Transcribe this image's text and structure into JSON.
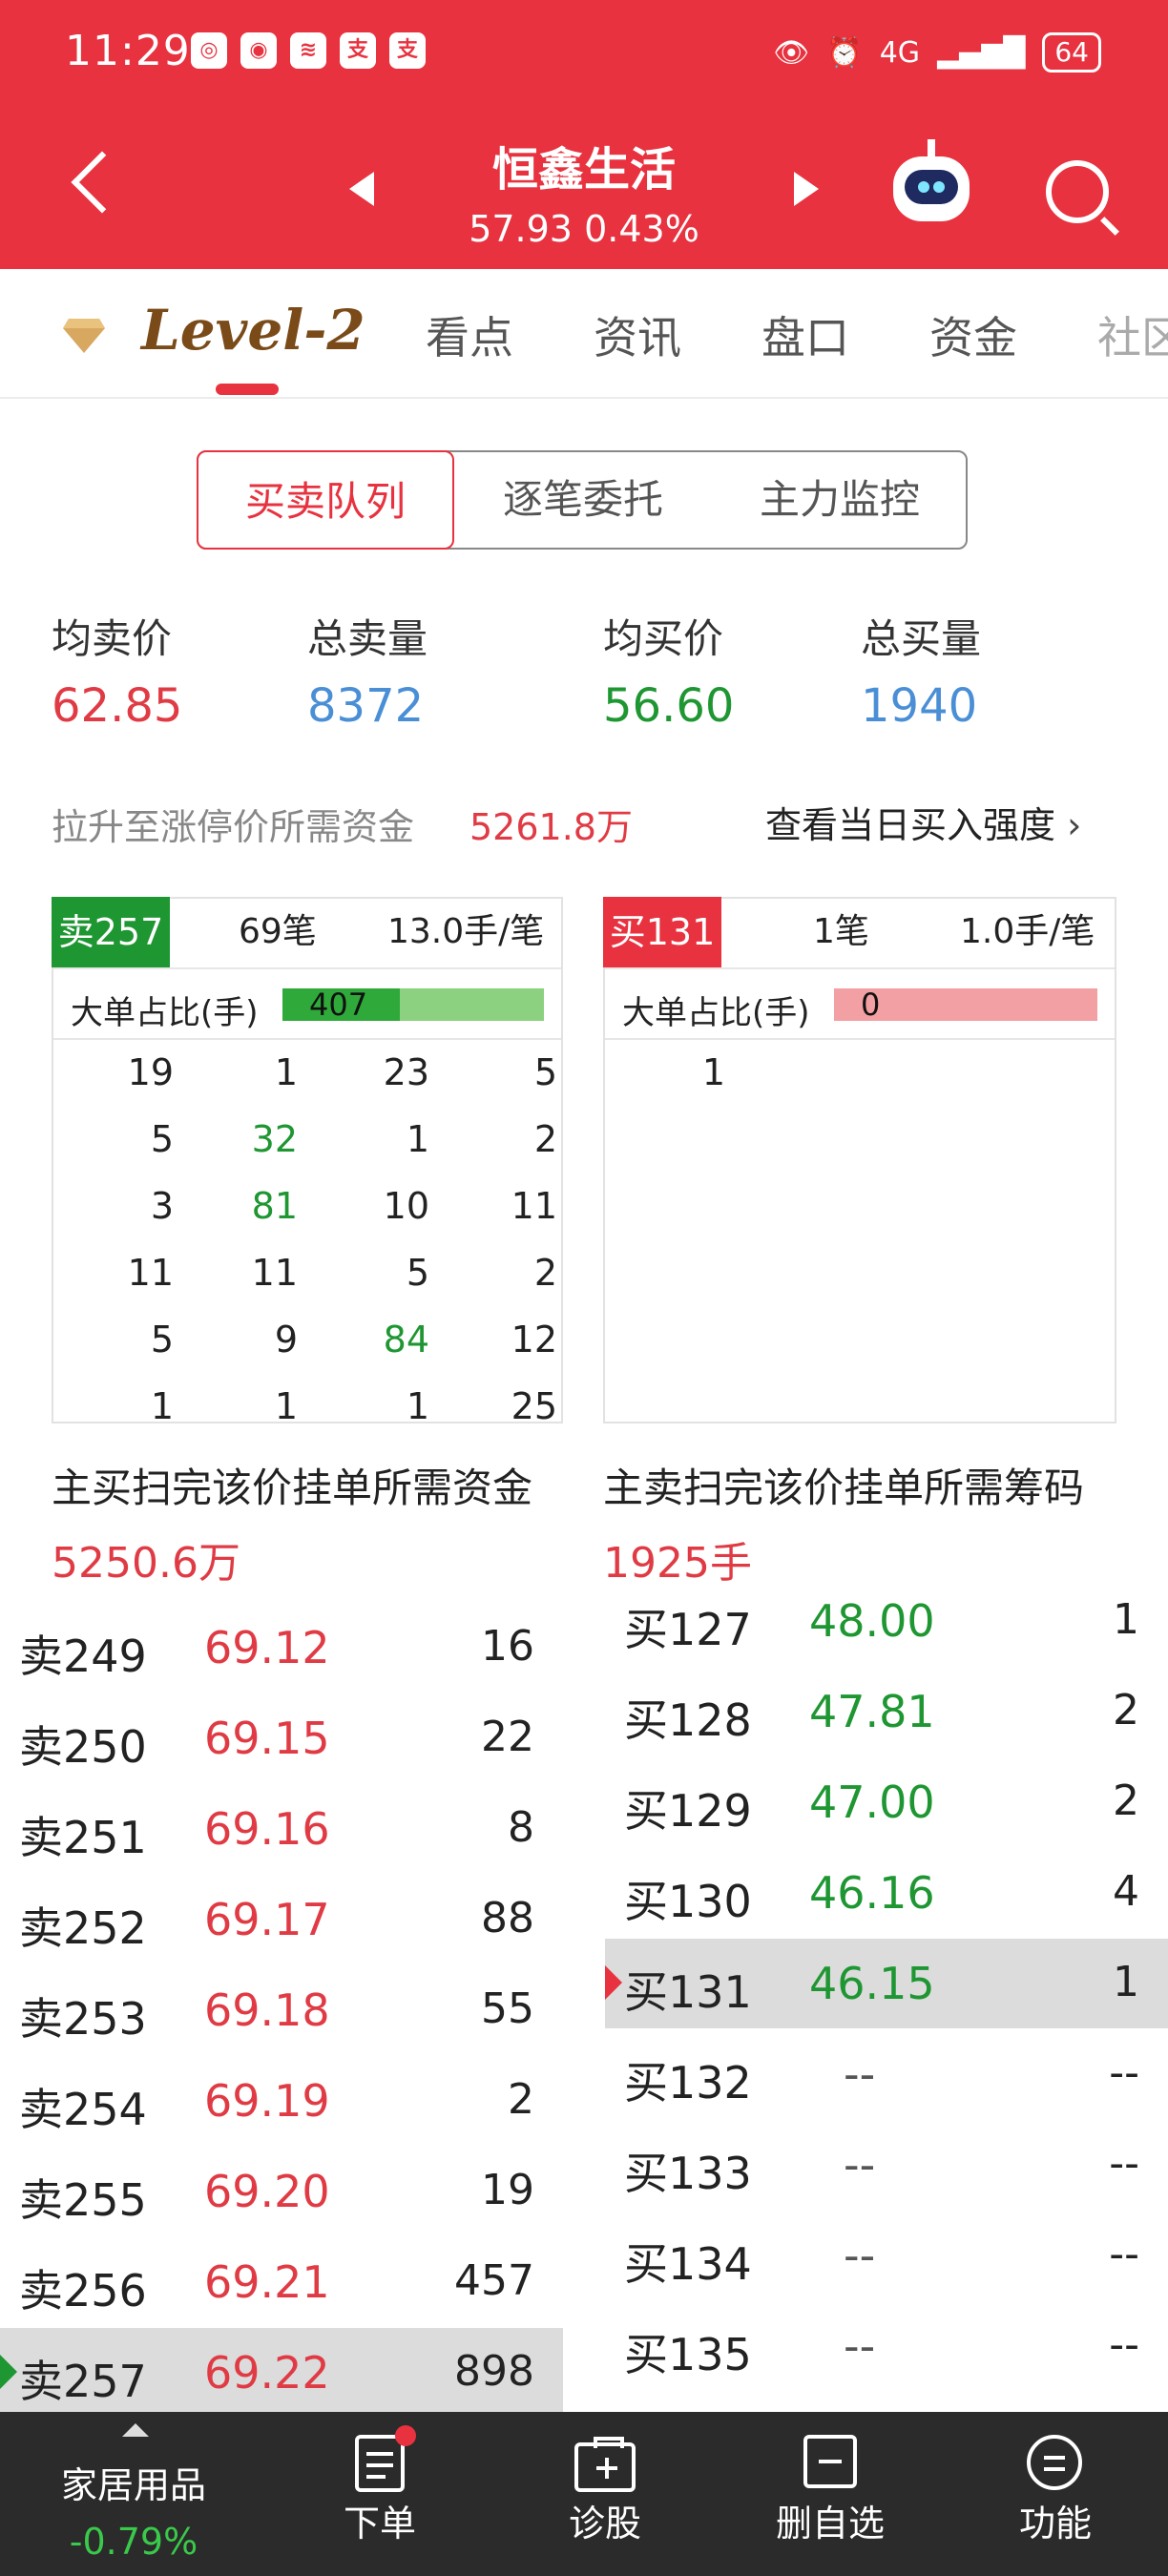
{
  "status_bar": {
    "time": "11:29",
    "signal": "4G",
    "battery": "64"
  },
  "header": {
    "stock_name": "恒鑫生活",
    "price": "57.93",
    "change": "0.43%"
  },
  "tabs": [
    "Level-2",
    "看点",
    "资讯",
    "盘口",
    "资金",
    "社区"
  ],
  "segments": [
    "买卖队列",
    "逐笔委托",
    "主力监控"
  ],
  "stats": {
    "avg_sell_label": "均卖价",
    "avg_sell": "62.85",
    "total_sell_label": "总卖量",
    "total_sell": "8372",
    "avg_buy_label": "均买价",
    "avg_buy": "56.60",
    "total_buy_label": "总买量",
    "total_buy": "1940"
  },
  "limit_up": {
    "label": "拉升至涨停价所需资金",
    "value": "5261.8万",
    "link": "查看当日买入强度"
  },
  "sell_queue": {
    "tag": "卖257",
    "orders": "69笔",
    "avg": "13.0手/笔",
    "ratio_label": "大单占比(手)",
    "ratio_value": "407",
    "ratio_fraction": 0.45,
    "cells": [
      [
        "19",
        "1",
        "23",
        "5"
      ],
      [
        "5",
        "32",
        "1",
        "2"
      ],
      [
        "3",
        "81",
        "10",
        "11"
      ],
      [
        "11",
        "11",
        "5",
        "2"
      ],
      [
        "5",
        "9",
        "84",
        "12"
      ],
      [
        "1",
        "1",
        "1",
        "25"
      ]
    ],
    "highlight": [
      "32",
      "81",
      "84"
    ]
  },
  "buy_queue": {
    "tag": "买131",
    "orders": "1笔",
    "avg": "1.0手/笔",
    "ratio_label": "大单占比(手)",
    "ratio_value": "0",
    "cells": [
      [
        "1"
      ]
    ]
  },
  "sell_need": {
    "label": "主买扫完该价挂单所需资金",
    "value": "5250.6万"
  },
  "buy_need": {
    "label": "主卖扫完该价挂单所需筹码",
    "value": "1925手"
  },
  "sell_ladder": [
    {
      "name": "卖249",
      "price": "69.12",
      "vol": "16"
    },
    {
      "name": "卖250",
      "price": "69.15",
      "vol": "22"
    },
    {
      "name": "卖251",
      "price": "69.16",
      "vol": "8"
    },
    {
      "name": "卖252",
      "price": "69.17",
      "vol": "88"
    },
    {
      "name": "卖253",
      "price": "69.18",
      "vol": "55"
    },
    {
      "name": "卖254",
      "price": "69.19",
      "vol": "2"
    },
    {
      "name": "卖255",
      "price": "69.20",
      "vol": "19"
    },
    {
      "name": "卖256",
      "price": "69.21",
      "vol": "457"
    },
    {
      "name": "卖257",
      "price": "69.22",
      "vol": "898"
    }
  ],
  "buy_ladder": [
    {
      "name": "买127",
      "price": "48.00",
      "vol": "1"
    },
    {
      "name": "买128",
      "price": "47.81",
      "vol": "2"
    },
    {
      "name": "买129",
      "price": "47.00",
      "vol": "2"
    },
    {
      "name": "买130",
      "price": "46.16",
      "vol": "4"
    },
    {
      "name": "买131",
      "price": "46.15",
      "vol": "1"
    },
    {
      "name": "买132",
      "price": "--",
      "vol": "--"
    },
    {
      "name": "买133",
      "price": "--",
      "vol": "--"
    },
    {
      "name": "买134",
      "price": "--",
      "vol": "--"
    },
    {
      "name": "买135",
      "price": "--",
      "vol": "--"
    }
  ],
  "bottom_nav": {
    "sector": "家居用品",
    "sector_change": "-0.79%",
    "order": "下单",
    "diagnose": "诊股",
    "remove_watch": "删自选",
    "functions": "功能"
  },
  "colors": {
    "red": "#e8323f",
    "green": "#1e9632",
    "blue": "#4a8fd6",
    "brown": "#7a4b18"
  }
}
